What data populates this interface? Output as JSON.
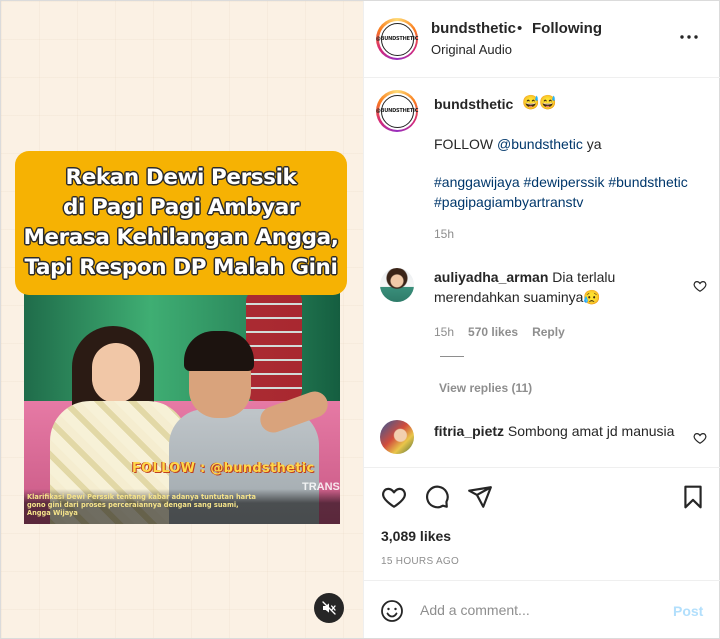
{
  "media": {
    "title_lines": [
      "Rekan Dewi Perssik",
      "di Pagi Pagi Ambyar",
      "Merasa Kehilangan Angga,",
      "Tapi Respon DP Malah Gini"
    ],
    "watermark": "FOLLOW : @bundsthetic",
    "channel_watermark": "TRANS",
    "video_caption": "Klarifikasi Dewi Perssik tentang kabar adanya tuntutan harta gono gini dari proses perceraiannya dengan sang suami, Angga Wijaya",
    "mute_icon": "speaker-muted-icon",
    "title_bg_color": "#f6b203"
  },
  "header": {
    "username": "bundsthetic",
    "separator": "•",
    "follow_status": "Following",
    "audio": "Original Audio",
    "avatar_text": "@BUNDSTHETIC",
    "more_icon": "more-horizontal-icon"
  },
  "caption": {
    "username": "bundsthetic",
    "emoji": "😅😅",
    "text_prefix": "FOLLOW ",
    "mention": "@bundsthetic",
    "text_suffix": " ya",
    "hashtags": [
      "#anggawijaya",
      "#dewiperssik",
      "#bundsthetic",
      "#pagipagiambyartranstv"
    ],
    "time": "15h"
  },
  "comments": [
    {
      "username": "auliyadha_arman",
      "text": "Dia terlalu merendahkan suaminya😥",
      "time": "15h",
      "likes": "570 likes",
      "reply_label": "Reply",
      "view_replies": "View replies (11)"
    },
    {
      "username": "fitria_pietz",
      "text": "Sombong amat jd manusia"
    }
  ],
  "actions": {
    "like_icon": "heart-outline-icon",
    "comment_icon": "comment-bubble-icon",
    "share_icon": "paper-plane-icon",
    "save_icon": "bookmark-icon",
    "likes_count": "3,089 likes",
    "time_ago": "15 HOURS AGO"
  },
  "composer": {
    "placeholder": "Add a comment...",
    "post_label": "Post",
    "emoji_icon": "smiley-face-icon"
  },
  "colors": {
    "link": "#00376b",
    "muted": "#8e8e8e",
    "post_disabled": "#b2dffc"
  }
}
